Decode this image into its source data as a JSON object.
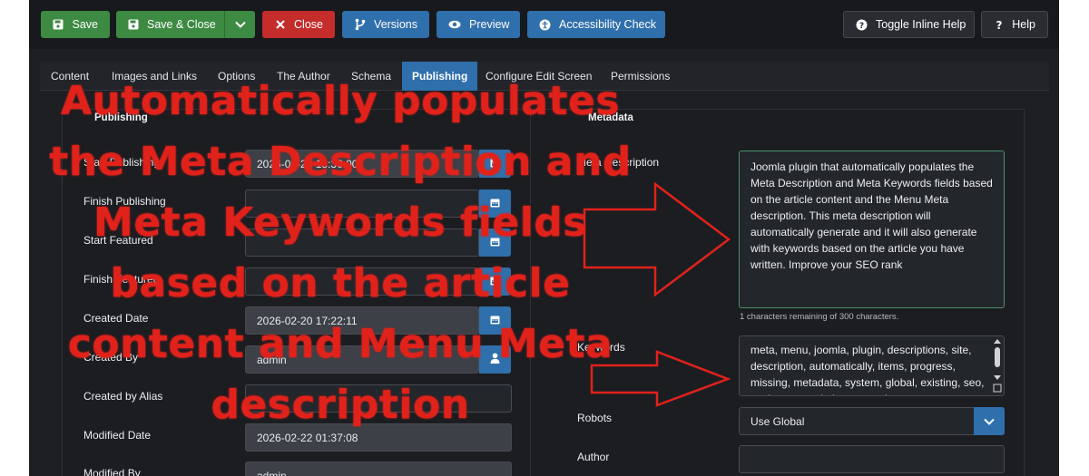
{
  "toolbar": {
    "save": "Save",
    "save_close": "Save & Close",
    "close": "Close",
    "versions": "Versions",
    "preview": "Preview",
    "accessibility_check": "Accessibility Check",
    "toggle_inline_help": "Toggle Inline Help",
    "help": "Help"
  },
  "tabs": [
    "Content",
    "Images and Links",
    "Options",
    "The Author",
    "Schema",
    "Publishing",
    "Configure Edit Screen",
    "Permissions"
  ],
  "active_tab": "Publishing",
  "publishing": {
    "legend": "Publishing",
    "start_publishing_label": "Start Publishing",
    "start_publishing_value": "2026-02-20 18:36:00",
    "finish_publishing_label": "Finish Publishing",
    "start_featured_label": "Start Featured",
    "finish_featured_label": "Finish Featured",
    "created_date_label": "Created Date",
    "created_date_value": "2026-02-20 17:22:11",
    "created_by_label": "Created By",
    "created_by_value": "admin",
    "created_by_alias_label": "Created by Alias",
    "modified_date_label": "Modified Date",
    "modified_date_value": "2026-02-22 01:37:08",
    "modified_by_label": "Modified By",
    "modified_by_value": "admin"
  },
  "metadata": {
    "legend": "Metadata",
    "meta_description_label": "Meta Description",
    "meta_description_value": "Joomla plugin that automatically populates the Meta Description and Meta Keywords fields based on the article content and the Menu Meta description. This meta description will automatically generate and it will also generate with keywords based on the article you have written. Improve your SEO rank",
    "counter": "1 characters remaining of 300 characters.",
    "keywords_label": "Keywords",
    "keywords_value": "meta, menu, joomla, plugin, descriptions, site, description, automatically, items, progress, missing, metadata, system, global, existing, seo, settings, completion, extension",
    "robots_label": "Robots",
    "robots_value": "Use Global",
    "author_label": "Author"
  },
  "overlay": {
    "caption_lines": [
      "Automatically populates",
      "the Meta Description and",
      "Meta Keywords fields",
      "based on the article",
      "content and Menu Meta",
      "description"
    ],
    "color": "#e0221b"
  },
  "colors": {
    "success": "#3d8a43",
    "danger": "#c52c2c",
    "primary": "#2f6fab",
    "background": "#1e1f23"
  }
}
